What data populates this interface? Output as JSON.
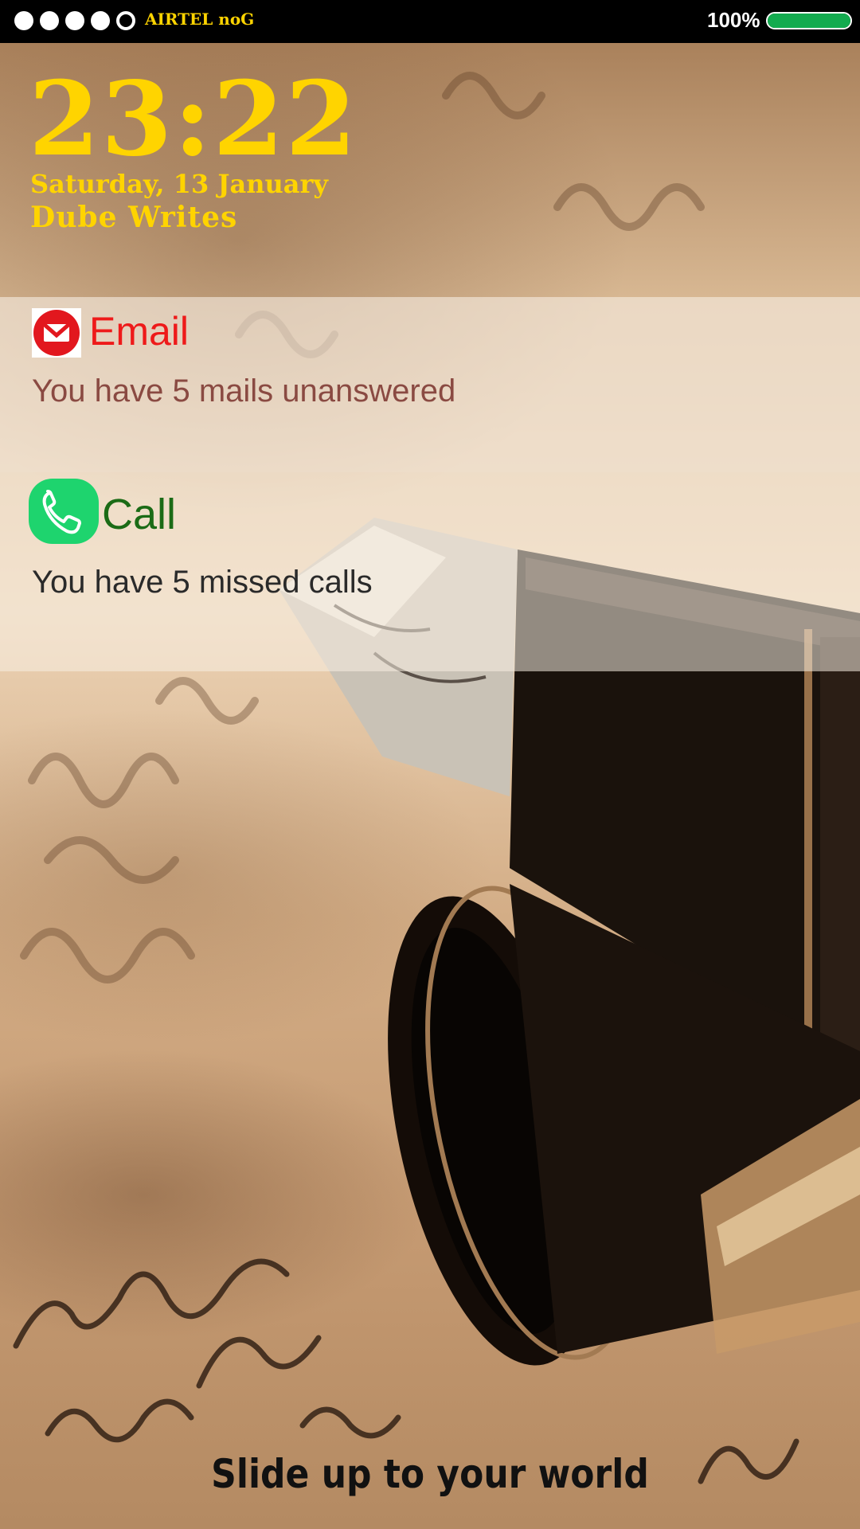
{
  "status_bar": {
    "signal_dots": [
      true,
      true,
      true,
      true,
      false
    ],
    "carrier": "AIRTEL noG",
    "battery_percent": "100%",
    "battery_level": 1.0,
    "battery_color": "#13ab4f"
  },
  "lockscreen": {
    "time": "23:22",
    "date": "Saturday, 13 January",
    "owner": "Dube Writes",
    "accent_color": "#ffd400"
  },
  "notifications": [
    {
      "app": "Email",
      "icon": "gmail-icon",
      "message": "You have 5 mails unanswered",
      "title_color": "#ee1a1a"
    },
    {
      "app": "Call",
      "icon": "phone-icon",
      "message": "You have 5 missed calls",
      "title_color": "#1b6b16"
    }
  ],
  "slide_hint": "Slide up to your world"
}
